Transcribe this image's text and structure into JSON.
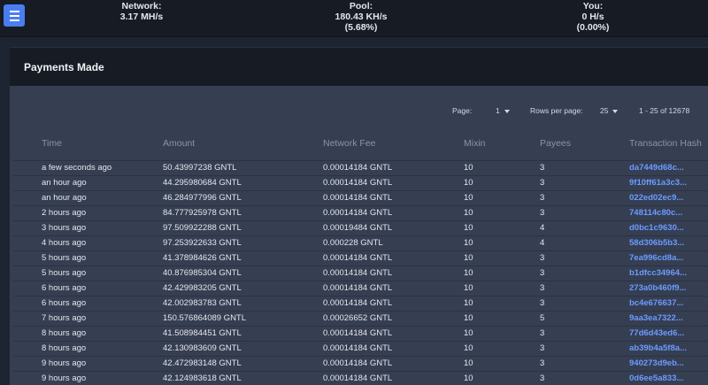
{
  "header": {
    "network": {
      "label": "Network:",
      "value": "3.17 MH/s"
    },
    "pool": {
      "label": "Pool:",
      "value": "180.43 KH/s",
      "percent": "(5.68%)"
    },
    "you": {
      "label": "You:",
      "value": "0 H/s",
      "percent": "(0.00%)"
    }
  },
  "panel": {
    "title": "Payments Made"
  },
  "pagination": {
    "page_label": "Page:",
    "page_value": "1",
    "rows_label": "Rows per page:",
    "rows_value": "25",
    "range": "1 - 25 of 12678"
  },
  "table": {
    "columns": [
      "Time",
      "Amount",
      "Network Fee",
      "Mixin",
      "Payees",
      "Transaction Hash"
    ],
    "rows": [
      [
        "a few seconds ago",
        "50.43997238 GNTL",
        "0.00014184 GNTL",
        "10",
        "3",
        "da7449d68c..."
      ],
      [
        "an hour ago",
        "44.295980684 GNTL",
        "0.00014184 GNTL",
        "10",
        "3",
        "9f10ff61a3c3..."
      ],
      [
        "an hour ago",
        "46.284977996 GNTL",
        "0.00014184 GNTL",
        "10",
        "3",
        "022ed02ec9..."
      ],
      [
        "2 hours ago",
        "84.777925978 GNTL",
        "0.00014184 GNTL",
        "10",
        "3",
        "748114c80c..."
      ],
      [
        "3 hours ago",
        "97.509922288 GNTL",
        "0.00019484 GNTL",
        "10",
        "4",
        "d0bc1c9630..."
      ],
      [
        "4 hours ago",
        "97.253922633 GNTL",
        "0.000228 GNTL",
        "10",
        "4",
        "58d306b5b3..."
      ],
      [
        "5 hours ago",
        "41.378984626 GNTL",
        "0.00014184 GNTL",
        "10",
        "3",
        "7ea996cd8a..."
      ],
      [
        "5 hours ago",
        "40.876985304 GNTL",
        "0.00014184 GNTL",
        "10",
        "3",
        "b1dfcc34964..."
      ],
      [
        "6 hours ago",
        "42.429983205 GNTL",
        "0.00014184 GNTL",
        "10",
        "3",
        "273a0b460f9..."
      ],
      [
        "6 hours ago",
        "42.002983783 GNTL",
        "0.00014184 GNTL",
        "10",
        "3",
        "bc4e676637..."
      ],
      [
        "7 hours ago",
        "150.576864089 GNTL",
        "0.00026652 GNTL",
        "10",
        "5",
        "9aa3ea7322..."
      ],
      [
        "8 hours ago",
        "41.508984451 GNTL",
        "0.00014184 GNTL",
        "10",
        "3",
        "77d6d43ed6..."
      ],
      [
        "8 hours ago",
        "42.130983609 GNTL",
        "0.00014184 GNTL",
        "10",
        "3",
        "ab39b4a5f8a..."
      ],
      [
        "9 hours ago",
        "42.472983148 GNTL",
        "0.00014184 GNTL",
        "10",
        "3",
        "940273d9eb..."
      ],
      [
        "9 hours ago",
        "42.124983618 GNTL",
        "0.00014184 GNTL",
        "10",
        "3",
        "0d6ee5a833..."
      ]
    ]
  }
}
